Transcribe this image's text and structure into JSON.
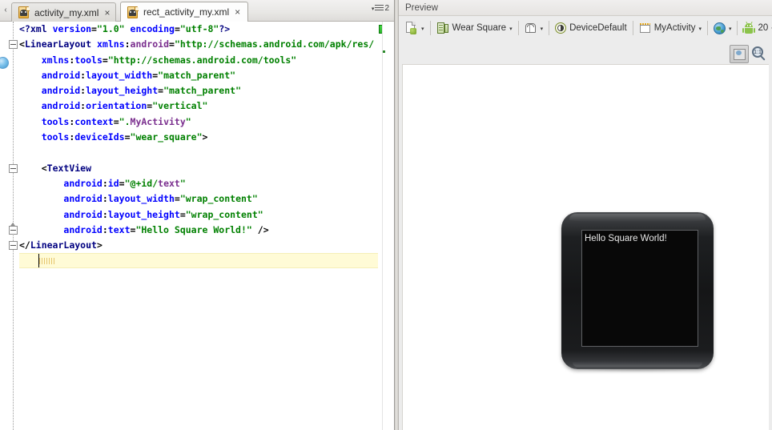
{
  "editor": {
    "tabs": [
      {
        "label": "activity_my.xml",
        "icon": "android-xml-file-icon",
        "close": "×",
        "active": false
      },
      {
        "label": "rect_activity_my.xml",
        "icon": "android-xml-file-icon",
        "close": "×",
        "active": true
      }
    ],
    "tab_overflow_count": "2",
    "scroll_left_arrow": "‹",
    "inspection_status_color": "#20a020",
    "code_lines": [
      {
        "indent": 0,
        "fold": null,
        "tokens": [
          {
            "t": "<?",
            "c": "c-pi"
          },
          {
            "t": "xml",
            "c": "c-tag"
          },
          {
            "t": " ",
            "c": "c-punct"
          },
          {
            "t": "version",
            "c": "c-attr"
          },
          {
            "t": "=",
            "c": "c-punct"
          },
          {
            "t": "\"1.0\"",
            "c": "c-val"
          },
          {
            "t": " ",
            "c": "c-punct"
          },
          {
            "t": "encoding",
            "c": "c-attr"
          },
          {
            "t": "=",
            "c": "c-punct"
          },
          {
            "t": "\"utf-8\"",
            "c": "c-val"
          },
          {
            "t": "?>",
            "c": "c-pi"
          }
        ]
      },
      {
        "indent": 0,
        "fold": "minus",
        "tokens": [
          {
            "t": "<",
            "c": "c-punct"
          },
          {
            "t": "LinearLayout",
            "c": "c-tag"
          },
          {
            "t": " ",
            "c": "c-punct"
          },
          {
            "t": "xmlns",
            "c": "c-attr"
          },
          {
            "t": ":",
            "c": "c-punct"
          },
          {
            "t": "android",
            "c": "c-ns"
          },
          {
            "t": "=",
            "c": "c-punct"
          },
          {
            "t": "\"http://schemas.android.com/apk/res/",
            "c": "c-val"
          }
        ]
      },
      {
        "indent": 4,
        "fold": null,
        "tokens": [
          {
            "t": "xmlns",
            "c": "c-attr"
          },
          {
            "t": ":",
            "c": "c-punct"
          },
          {
            "t": "tools",
            "c": "c-attr"
          },
          {
            "t": "=",
            "c": "c-punct"
          },
          {
            "t": "\"http://schemas.android.com/tools\"",
            "c": "c-val"
          }
        ]
      },
      {
        "indent": 4,
        "fold": null,
        "tokens": [
          {
            "t": "android",
            "c": "c-attr"
          },
          {
            "t": ":",
            "c": "c-punct"
          },
          {
            "t": "layout_width",
            "c": "c-attr"
          },
          {
            "t": "=",
            "c": "c-punct"
          },
          {
            "t": "\"match_parent\"",
            "c": "c-val"
          }
        ]
      },
      {
        "indent": 4,
        "fold": null,
        "tokens": [
          {
            "t": "android",
            "c": "c-attr"
          },
          {
            "t": ":",
            "c": "c-punct"
          },
          {
            "t": "layout_height",
            "c": "c-attr"
          },
          {
            "t": "=",
            "c": "c-punct"
          },
          {
            "t": "\"match_parent\"",
            "c": "c-val"
          }
        ]
      },
      {
        "indent": 4,
        "fold": null,
        "tokens": [
          {
            "t": "android",
            "c": "c-attr"
          },
          {
            "t": ":",
            "c": "c-punct"
          },
          {
            "t": "orientation",
            "c": "c-attr"
          },
          {
            "t": "=",
            "c": "c-punct"
          },
          {
            "t": "\"vertical\"",
            "c": "c-val"
          }
        ]
      },
      {
        "indent": 4,
        "fold": null,
        "tokens": [
          {
            "t": "tools",
            "c": "c-attr"
          },
          {
            "t": ":",
            "c": "c-punct"
          },
          {
            "t": "context",
            "c": "c-attr"
          },
          {
            "t": "=",
            "c": "c-punct"
          },
          {
            "t": "\".",
            "c": "c-val"
          },
          {
            "t": "MyActivity",
            "c": "c-res"
          },
          {
            "t": "\"",
            "c": "c-val"
          }
        ]
      },
      {
        "indent": 4,
        "fold": null,
        "tokens": [
          {
            "t": "tools",
            "c": "c-attr"
          },
          {
            "t": ":",
            "c": "c-punct"
          },
          {
            "t": "deviceIds",
            "c": "c-attr"
          },
          {
            "t": "=",
            "c": "c-punct"
          },
          {
            "t": "\"wear_square\"",
            "c": "c-val"
          },
          {
            "t": ">",
            "c": "c-punct"
          }
        ]
      },
      {
        "indent": 0,
        "fold": null,
        "tokens": []
      },
      {
        "indent": 4,
        "fold": "minus",
        "tokens": [
          {
            "t": "<",
            "c": "c-punct"
          },
          {
            "t": "TextView",
            "c": "c-tag"
          }
        ]
      },
      {
        "indent": 8,
        "fold": null,
        "tokens": [
          {
            "t": "android",
            "c": "c-attr"
          },
          {
            "t": ":",
            "c": "c-punct"
          },
          {
            "t": "id",
            "c": "c-attr"
          },
          {
            "t": "=",
            "c": "c-punct"
          },
          {
            "t": "\"@+id/",
            "c": "c-val"
          },
          {
            "t": "text",
            "c": "c-res"
          },
          {
            "t": "\"",
            "c": "c-val"
          }
        ]
      },
      {
        "indent": 8,
        "fold": null,
        "tokens": [
          {
            "t": "android",
            "c": "c-attr"
          },
          {
            "t": ":",
            "c": "c-punct"
          },
          {
            "t": "layout_width",
            "c": "c-attr"
          },
          {
            "t": "=",
            "c": "c-punct"
          },
          {
            "t": "\"wrap_content\"",
            "c": "c-val"
          }
        ]
      },
      {
        "indent": 8,
        "fold": null,
        "tokens": [
          {
            "t": "android",
            "c": "c-attr"
          },
          {
            "t": ":",
            "c": "c-punct"
          },
          {
            "t": "layout_height",
            "c": "c-attr"
          },
          {
            "t": "=",
            "c": "c-punct"
          },
          {
            "t": "\"wrap_content\"",
            "c": "c-val"
          }
        ]
      },
      {
        "indent": 8,
        "fold": "tri-up",
        "tokens": [
          {
            "t": "android",
            "c": "c-attr"
          },
          {
            "t": ":",
            "c": "c-punct"
          },
          {
            "t": "text",
            "c": "c-attr"
          },
          {
            "t": "=",
            "c": "c-punct"
          },
          {
            "t": "\"Hello Square World!\"",
            "c": "c-val"
          },
          {
            "t": " />",
            "c": "c-punct"
          }
        ]
      },
      {
        "indent": 0,
        "fold": "minus",
        "tokens": [
          {
            "t": "</",
            "c": "c-punct"
          },
          {
            "t": "LinearLayout",
            "c": "c-tag"
          },
          {
            "t": ">",
            "c": "c-punct"
          }
        ]
      }
    ]
  },
  "preview": {
    "header_title": "Preview",
    "toolbar": [
      {
        "name": "config-chooser",
        "icon": "document-config-icon",
        "label": "",
        "caret": "▾"
      },
      {
        "name": "device-chooser",
        "icon": "device-icon",
        "label": "Wear Square",
        "caret": "▾"
      },
      {
        "name": "orientation-chooser",
        "icon": "orientation-icon",
        "label": "",
        "caret": "▾"
      },
      {
        "name": "theme-chooser",
        "icon": "theme-icon",
        "label": "DeviceDefault",
        "caret": ""
      },
      {
        "name": "activity-chooser",
        "icon": "activity-icon",
        "label": "MyActivity",
        "caret": "▾"
      },
      {
        "name": "locale-chooser",
        "icon": "globe-icon",
        "label": "",
        "caret": "▾"
      },
      {
        "name": "api-chooser",
        "icon": "android-icon",
        "label": "20",
        "caret": "▾"
      }
    ],
    "zoom_fit_label": "zoom-to-fit",
    "zoom_actual_label": "1:1",
    "zoom_actual_glyph": "1:1",
    "device": {
      "name": "Wear Square",
      "screen_text": "Hello Square World!",
      "screen_bg": "#080808",
      "body_color": "#17181a"
    }
  }
}
